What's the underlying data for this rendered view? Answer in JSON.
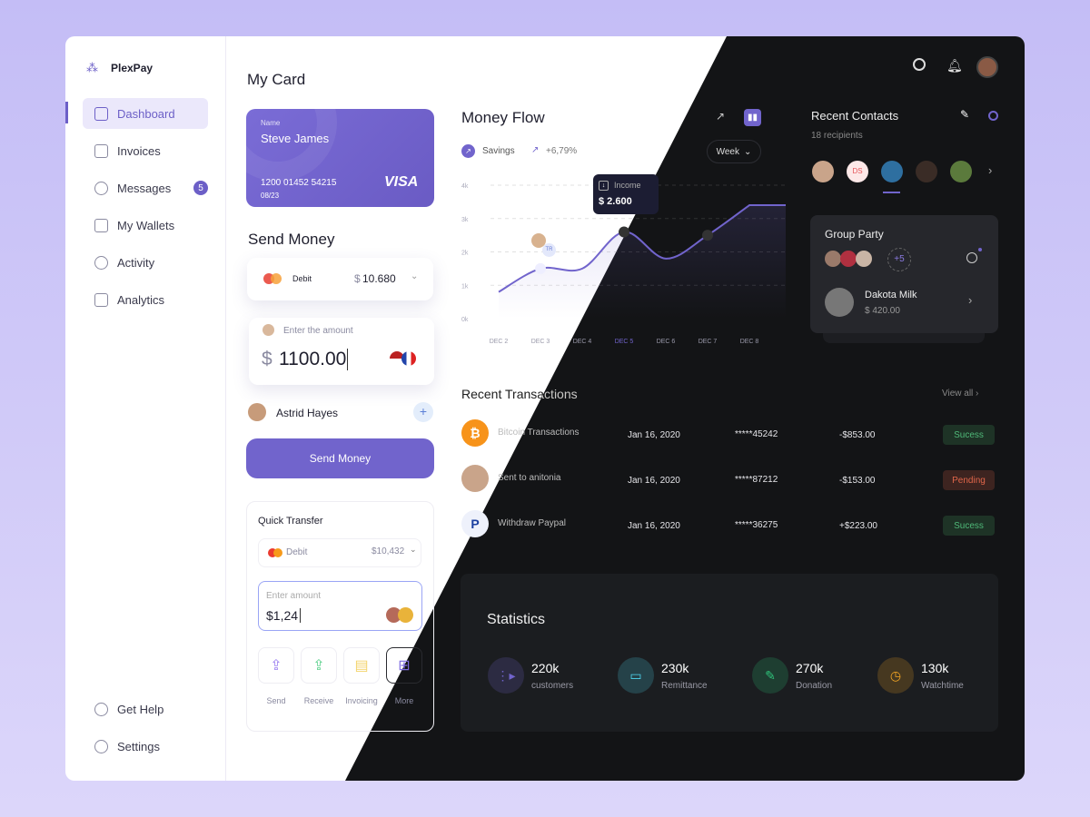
{
  "brand": "PlexPay",
  "sidebar": {
    "items": [
      {
        "label": "Dashboard"
      },
      {
        "label": "Invoices"
      },
      {
        "label": "Messages",
        "badge": "5"
      },
      {
        "label": "My Wallets"
      },
      {
        "label": "Activity"
      },
      {
        "label": "Analytics"
      }
    ],
    "bottom": [
      {
        "label": "Get Help"
      },
      {
        "label": "Settings"
      }
    ]
  },
  "my_card": {
    "title": "My Card",
    "name_label": "Name",
    "name": "Steve James",
    "number": "1200 01452 54215",
    "expiry": "08/23",
    "brand": "VISA"
  },
  "send_money": {
    "title": "Send Money",
    "account": "Debit",
    "balance_currency": "$",
    "balance": "10.680",
    "amount_placeholder": "Enter the amount",
    "currency": "$",
    "amount": "1100.00",
    "recipient": "Astrid Hayes",
    "button": "Send Money"
  },
  "quick_transfer": {
    "title": "Quick Transfer",
    "account": "Debit",
    "balance": "$10,432",
    "amount_label": "Enter amount",
    "amount": "$1,24",
    "actions": [
      {
        "label": "Send",
        "icon": "send-money-icon"
      },
      {
        "label": "Receive",
        "icon": "receive-money-icon"
      },
      {
        "label": "Invoicing",
        "icon": "invoice-icon"
      },
      {
        "label": "More",
        "icon": "more-apps-icon"
      }
    ]
  },
  "money_flow": {
    "title": "Money Flow",
    "legend": "Savings",
    "change": "+6,79%",
    "period": "Week",
    "tooltip_label": "Income",
    "tooltip_value": "$ 2.600",
    "avatar_tag": "TR"
  },
  "chart_data": {
    "type": "area",
    "x": [
      "DEC 2",
      "DEC 3",
      "DEC 4",
      "DEC 5",
      "DEC 6",
      "DEC 7",
      "DEC 8"
    ],
    "values": [
      0.8,
      1.5,
      1.5,
      2.6,
      1.8,
      2.5,
      3.4
    ],
    "yticks": [
      "0k",
      "1k",
      "2k",
      "3k",
      "4k"
    ],
    "ylim": [
      0,
      4
    ],
    "highlight": "DEC 5",
    "color": "#7164cc",
    "grid": true
  },
  "contacts": {
    "title": "Recent Contacts",
    "subtitle": "18 recipients",
    "initials": "DS",
    "group": {
      "title": "Group Party",
      "more": "+5",
      "person": "Dakota Milk",
      "amount": "$ 420.00"
    }
  },
  "transactions": {
    "title": "Recent Transactions",
    "view_all": "View all",
    "rows": [
      {
        "name": "Bitcoin Transactions",
        "date": "Jan 16, 2020",
        "card": "*****45242",
        "amount": "-$853.00",
        "status": "Sucess",
        "icon": "bitcoin-icon"
      },
      {
        "name": "Sent to anitonia",
        "date": "Jan 16, 2020",
        "card": "*****87212",
        "amount": "-$153.00",
        "status": "Pending",
        "icon": "avatar"
      },
      {
        "name": "Withdraw Paypal",
        "date": "Jan 16, 2020",
        "card": "*****36275",
        "amount": "+$223.00",
        "status": "Sucess",
        "icon": "paypal-icon"
      }
    ]
  },
  "statistics": {
    "title": "Statistics",
    "items": [
      {
        "value": "220k",
        "label": "customers",
        "color": "#7164cc"
      },
      {
        "value": "230k",
        "label": "Remittance",
        "color": "#4fd6ee"
      },
      {
        "value": "270k",
        "label": "Donation",
        "color": "#2fc27a"
      },
      {
        "value": "130k",
        "label": "Watchtime",
        "color": "#f5a623"
      }
    ]
  }
}
